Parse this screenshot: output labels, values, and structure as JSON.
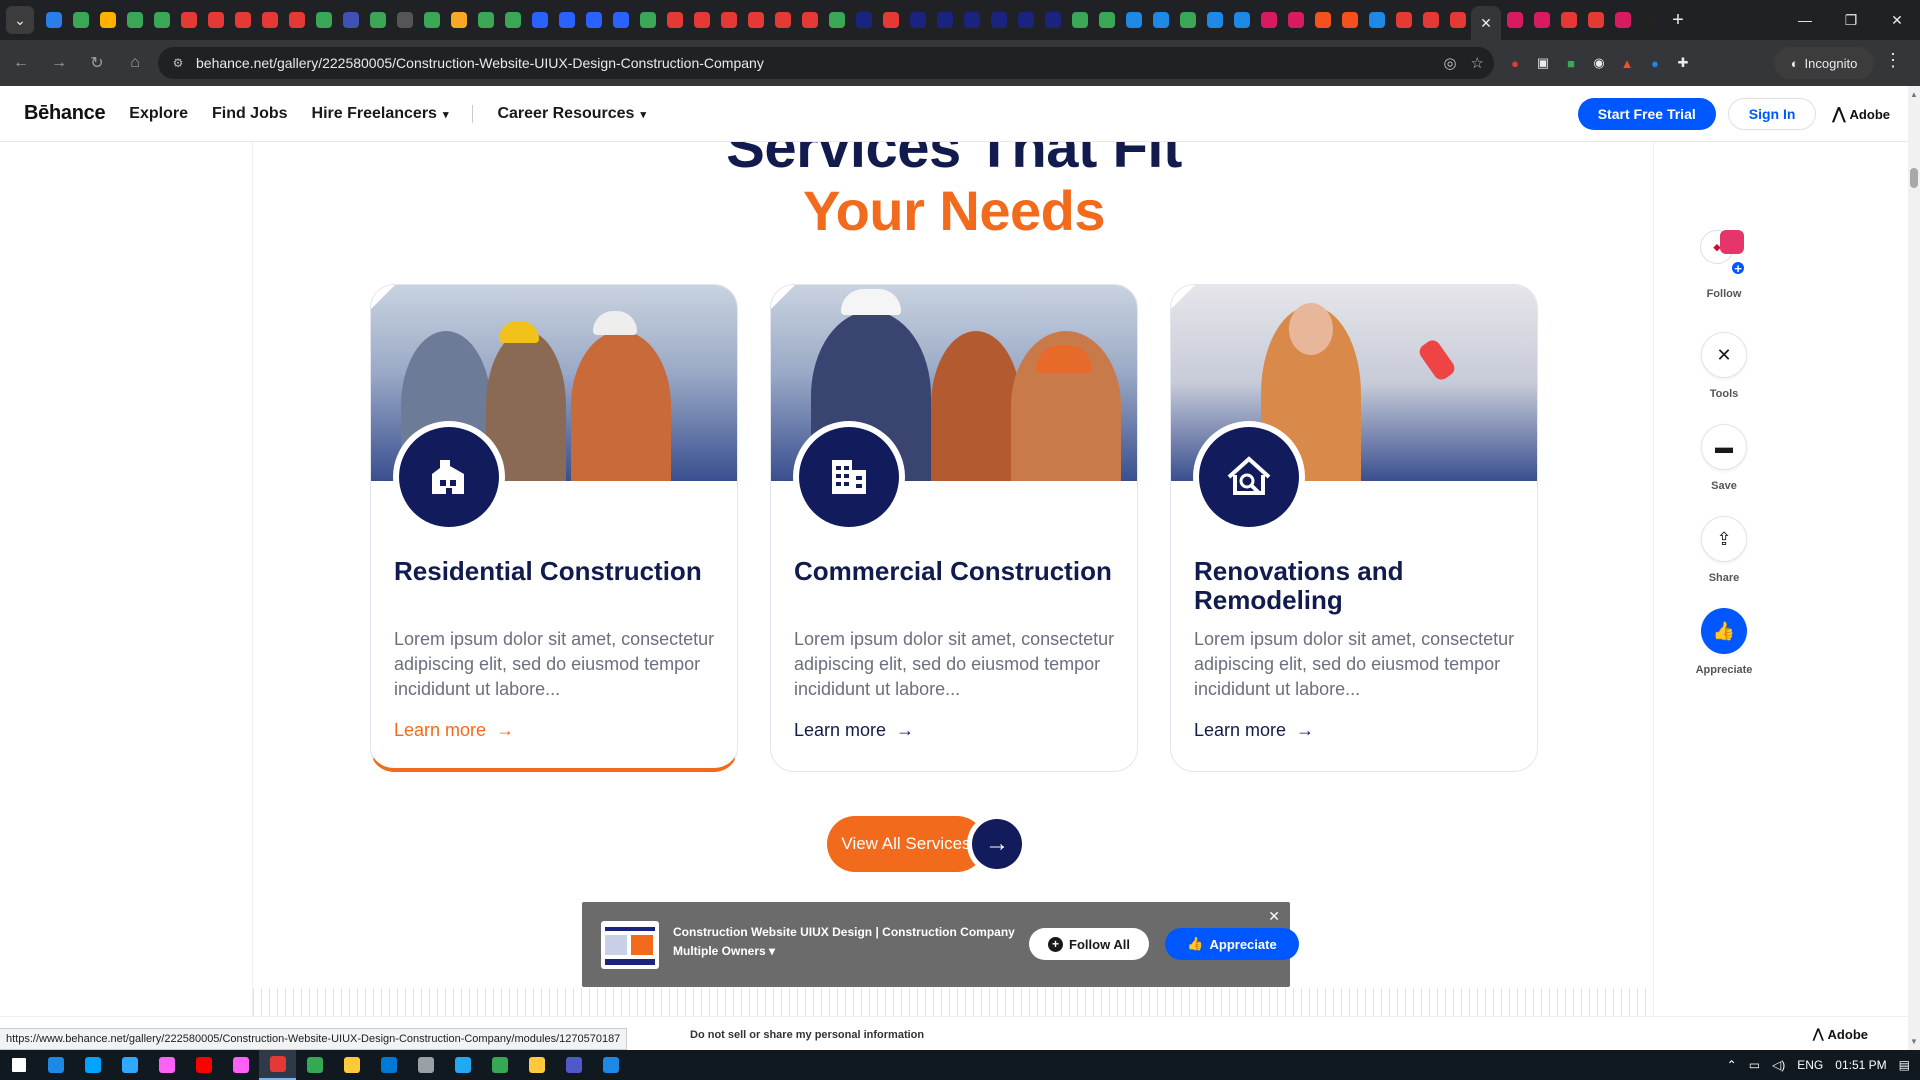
{
  "browser": {
    "url": "behance.net/gallery/222580005/Construction-Website-UIUX-Design-Construction-Company",
    "incognito_label": "Incognito",
    "status_url": "https://www.behance.net/gallery/222580005/Construction-Website-UIUX-Design-Construction-Company/modules/1270570187",
    "tab_favicons": [
      "#2b7de9",
      "#3aa757",
      "#ffb300",
      "#3aa757",
      "#3aa757",
      "#e53935",
      "#e53935",
      "#e53935",
      "#e53935",
      "#e53935",
      "#3aa757",
      "#3f51b5",
      "#3aa757",
      "#555555",
      "#3aa757",
      "#f9a825",
      "#3aa757",
      "#3aa757",
      "#2962ff",
      "#2962ff",
      "#2962ff",
      "#2962ff",
      "#3aa757",
      "#e53935",
      "#e53935",
      "#e53935",
      "#e53935",
      "#e53935",
      "#e53935",
      "#3aa757",
      "#1a237e",
      "#e53935",
      "#1a237e",
      "#1a237e",
      "#1a237e",
      "#1a237e",
      "#1a237e",
      "#1a237e",
      "#3aa757",
      "#3aa757",
      "#1e88e5",
      "#1e88e5",
      "#3aa757",
      "#1e88e5",
      "#1e88e5",
      "#d81b60",
      "#d81b60",
      "#f4511e",
      "#f4511e",
      "#1e88e5",
      "#e53935",
      "#e53935",
      "#e53935"
    ],
    "tab_favicons_after": [
      "#d81b60",
      "#d81b60",
      "#e53935",
      "#e53935",
      "#d81b60",
      "#222222"
    ]
  },
  "behance": {
    "logo": "Bēhance",
    "nav": {
      "explore": "Explore",
      "find_jobs": "Find Jobs",
      "hire_freelancers": "Hire Freelancers",
      "career_resources": "Career Resources"
    },
    "start_trial": "Start Free Trial",
    "sign_in": "Sign In",
    "adobe": "Adobe",
    "privacy": "Do not sell or share my personal information"
  },
  "section": {
    "title_line1": "Services That Fit",
    "title_line2": "Your Needs",
    "cards": [
      {
        "title": "Residential Construction",
        "desc": "Lorem ipsum dolor sit amet, consectetur adipiscing elit, sed do eiusmod tempor incididunt ut labore...",
        "link": "Learn more"
      },
      {
        "title": "Commercial Construction",
        "desc": "Lorem ipsum dolor sit amet, consectetur adipiscing elit, sed do eiusmod tempor incididunt ut labore...",
        "link": "Learn more"
      },
      {
        "title": "Renovations and Remodeling",
        "desc": "Lorem ipsum dolor sit amet, consectetur adipiscing elit, sed do eiusmod tempor incididunt ut labore...",
        "link": "Learn more"
      }
    ],
    "view_all": "View All Services"
  },
  "rail": {
    "follow": "Follow",
    "tools": "Tools",
    "save": "Save",
    "share": "Share",
    "appreciate": "Appreciate"
  },
  "popup": {
    "title": "Construction Website UIUX Design | Construction Company",
    "owners": "Multiple Owners",
    "follow_all": "Follow All",
    "appreciate": "Appreciate"
  },
  "taskbar": {
    "lang": "ENG",
    "time": "01:51 PM",
    "apps": [
      "#1e88e5",
      "#00a3ff",
      "#31a8ff",
      "#ff61f6",
      "#ff0000",
      "#ff61f6",
      "#e53935",
      "#34a853",
      "#ffc83d",
      "#0078d4",
      "#9aa0a6",
      "#23a9f2",
      "#34a853",
      "#ffc83d",
      "#5059c9",
      "#1e88e5"
    ]
  },
  "colors": {
    "navy": "#111b4e",
    "orange": "#f26a1b",
    "behance_blue": "#0057ff"
  }
}
